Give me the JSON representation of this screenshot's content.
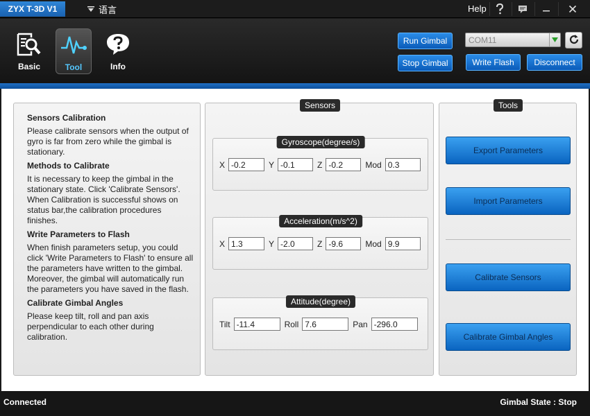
{
  "window": {
    "title": "ZYX T-3D V1",
    "language_label": "语言",
    "help_label": "Help",
    "icons": [
      "question-icon",
      "feedback-icon",
      "minimize-icon",
      "close-icon"
    ]
  },
  "nav": {
    "items": [
      {
        "label": "Basic",
        "icon": "magnifier-doc-icon"
      },
      {
        "label": "Tool",
        "icon": "waveform-icon",
        "active": true
      },
      {
        "label": "Info",
        "icon": "question-bubble-icon"
      }
    ]
  },
  "connection": {
    "run_gimbal": "Run Gimbal",
    "stop_gimbal": "Stop Gimbal",
    "write_flash": "Write Flash",
    "disconnect": "Disconnect",
    "port": "COM11"
  },
  "info_panel": {
    "sections": [
      {
        "heading": "Sensors Calibration",
        "text": "Please calibrate sensors when the output of gyro is far from zero while the gimbal is stationary."
      },
      {
        "heading": "Methods to Calibrate",
        "text": "It is necessary to keep the gimbal in the stationary state. Click 'Calibrate Sensors'. When Calibration is successful shows on status bar,the calibration procedures finishes."
      },
      {
        "heading": "Write Parameters to Flash",
        "text": "When finish parameters setup, you could click 'Write Parameters to Flash' to ensure all the parameters have written to the gimbal. Moreover, the gimbal will automatically run the parameters you have saved in the flash."
      },
      {
        "heading": "Calibrate Gimbal Angles",
        "text": "Please keep tilt, roll and pan axis perpendicular to each other during calibration."
      }
    ]
  },
  "sensors": {
    "title": "Sensors",
    "gyroscope": {
      "title": "Gyroscope(degree/s)",
      "x_label": "X",
      "y_label": "Y",
      "z_label": "Z",
      "mod_label": "Mod",
      "x": "-0.2",
      "y": "-0.1",
      "z": "-0.2",
      "mod": "0.3"
    },
    "acceleration": {
      "title": "Acceleration(m/s^2)",
      "x_label": "X",
      "y_label": "Y",
      "z_label": "Z",
      "mod_label": "Mod",
      "x": "1.3",
      "y": "-2.0",
      "z": "-9.6",
      "mod": "9.9"
    },
    "attitude": {
      "title": "Attitude(degree)",
      "tilt_label": "Tilt",
      "roll_label": "Roll",
      "pan_label": "Pan",
      "tilt": "-11.4",
      "roll": "7.6",
      "pan": "-296.0"
    }
  },
  "tools": {
    "title": "Tools",
    "export": "Export Parameters",
    "import": "Import Parameters",
    "calibrate_sensors": "Calibrate Sensors",
    "calibrate_angles": "Calibrate Gimbal Angles"
  },
  "status": {
    "connection": "Connected",
    "gimbal_state": "Gimbal State : Stop"
  },
  "colors": {
    "accent": "#1a6fd0",
    "button": "#0b5bb8",
    "active_nav_text": "#55c8ff"
  }
}
